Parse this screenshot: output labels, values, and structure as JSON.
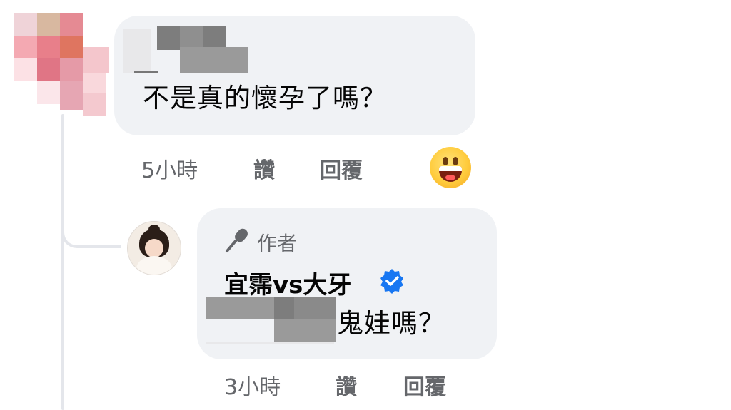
{
  "comments": [
    {
      "text": "不是真的懷孕了嗎？",
      "time": "5小時",
      "like_label": "讚",
      "reply_label": "回覆",
      "reaction_icon": "grinning-face-emoji"
    },
    {
      "author_badge": "作者",
      "author_name": "宜霈vs大牙",
      "verified": true,
      "text": "鬼娃嗎？",
      "time": "3小時",
      "like_label": "讚",
      "reply_label": "回覆"
    }
  ],
  "colors": {
    "bubble": "#f0f2f5",
    "meta_text": "#65676b",
    "verified": "#1877f2",
    "thread_line": "#e4e6eb"
  }
}
